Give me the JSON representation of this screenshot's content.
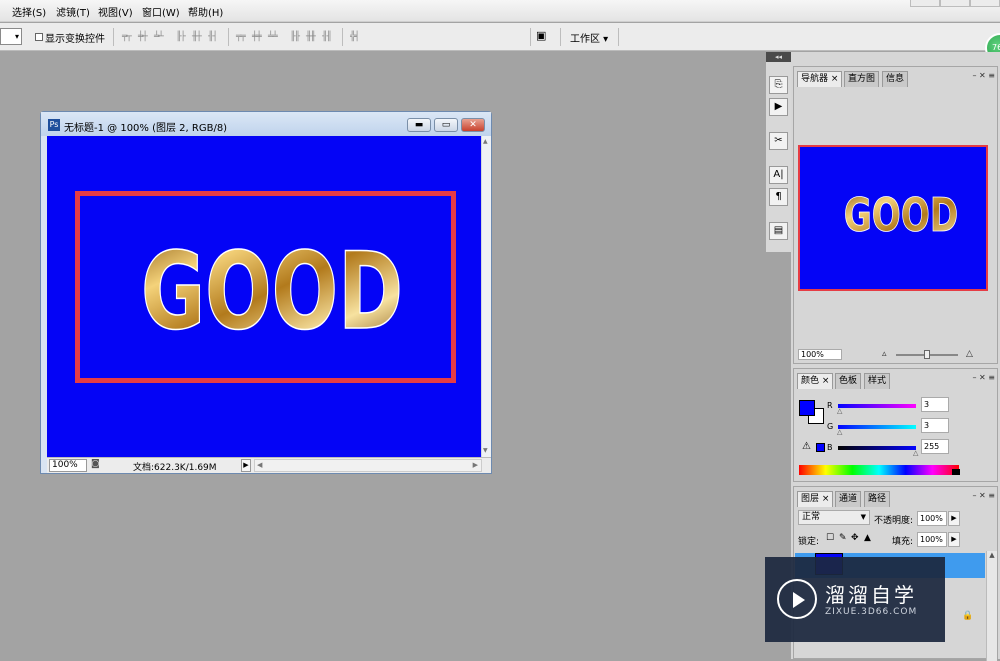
{
  "menu": [
    "选择(S)",
    "滤镜(T)",
    "视图(V)",
    "窗口(W)",
    "帮助(H)"
  ],
  "options": {
    "show_transform_label": "显示变换控件",
    "workspace_label": "工作区 ▾"
  },
  "badge": "76",
  "document": {
    "title": "无标题-1 @ 100% (图层 2, RGB/8)",
    "zoom": "100%",
    "doc_size": "文档:622.3K/1.69M",
    "canvas_text": "GOOD",
    "canvas_color": "#0404f6",
    "frame_color": "#e63c44"
  },
  "navigator": {
    "tabs": [
      "导航器",
      "直方图",
      "信息"
    ],
    "zoom": "100%"
  },
  "color": {
    "tabs": [
      "颜色",
      "色板",
      "样式"
    ],
    "channels": [
      {
        "label": "R",
        "value": "3"
      },
      {
        "label": "G",
        "value": "3"
      },
      {
        "label": "B",
        "value": "255"
      }
    ],
    "foreground": "#0000ff"
  },
  "layers": {
    "tabs": [
      "图层",
      "通道",
      "路径"
    ],
    "blend_mode": "正常",
    "opacity_label": "不透明度:",
    "opacity": "100%",
    "lock_label": "锁定:",
    "fill_label": "填充:",
    "fill": "100%"
  },
  "watermark": {
    "title": "溜溜自学",
    "subtitle": "ZIXUE.3D66.COM"
  }
}
